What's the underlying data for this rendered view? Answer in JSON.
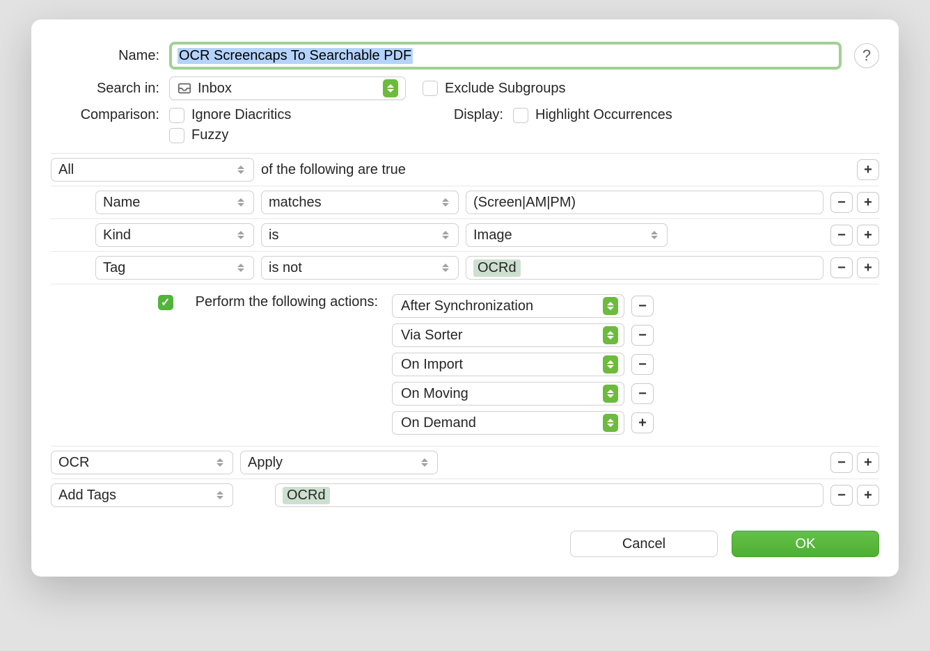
{
  "header": {
    "nameLabel": "Name:",
    "nameValue": "OCR Screencaps To Searchable PDF",
    "helpSymbol": "?"
  },
  "searchIn": {
    "label": "Search in:",
    "value": "Inbox",
    "excludeLabel": "Exclude Subgroups"
  },
  "comparison": {
    "label": "Comparison:",
    "opt1": "Ignore Diacritics",
    "opt2": "Fuzzy"
  },
  "display": {
    "label": "Display:",
    "opt1": "Highlight Occurrences"
  },
  "rules": {
    "root": "All",
    "rootSuffix": "of the following are true",
    "rows": [
      {
        "field": "Name",
        "op": "matches",
        "value": "(Screen|AM|PM)",
        "chip": false
      },
      {
        "field": "Kind",
        "op": "is",
        "value": "Image",
        "chip": false,
        "valueIsSelect": true
      },
      {
        "field": "Tag",
        "op": "is not",
        "value": "OCRd",
        "chip": true
      }
    ]
  },
  "actions": {
    "label": "Perform the following actions:",
    "triggers": [
      {
        "label": "After Synchronization",
        "pm": "-"
      },
      {
        "label": "Via Sorter",
        "pm": "-"
      },
      {
        "label": "On Import",
        "pm": "-"
      },
      {
        "label": "On Moving",
        "pm": "-"
      },
      {
        "label": "On Demand",
        "pm": "+"
      }
    ]
  },
  "steps": [
    {
      "action": "OCR",
      "param": "Apply",
      "value": null
    },
    {
      "action": "Add Tags",
      "param": null,
      "value": "OCRd",
      "chip": true
    }
  ],
  "footer": {
    "cancel": "Cancel",
    "ok": "OK"
  }
}
